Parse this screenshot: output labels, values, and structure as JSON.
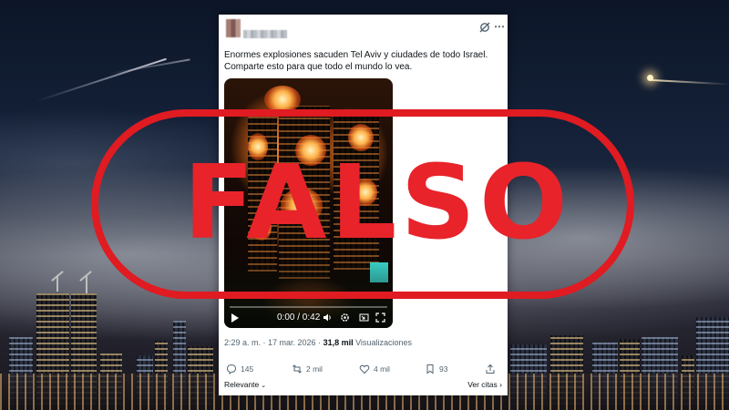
{
  "tweet": {
    "text_line1": "Enormes explosiones sacuden Tel Aviv y ciudades de todo Israel.",
    "text_line2": "Comparte esto para que todo el mundo lo vea.",
    "video_time": "0:00 / 0:42",
    "timestamp": "2:29 a. m. · 17 mar. 2026 · ",
    "views_count": "31,8 mil",
    "views_label": " Visualizaciones",
    "actions": {
      "replies": "145",
      "reposts": "2 mil",
      "likes": "4 mil",
      "bookmarks": "93"
    },
    "sort_label": "Relevante",
    "quotes_label": "Ver citas"
  },
  "stamp": {
    "label": "FALSO",
    "color": "#e01b22"
  },
  "icons": [
    "grok-icon",
    "more-icon",
    "play-icon",
    "volume-icon",
    "settings-icon",
    "pip-icon",
    "fullscreen-icon",
    "reply-icon",
    "repost-icon",
    "like-icon",
    "bookmark-icon",
    "share-icon"
  ]
}
